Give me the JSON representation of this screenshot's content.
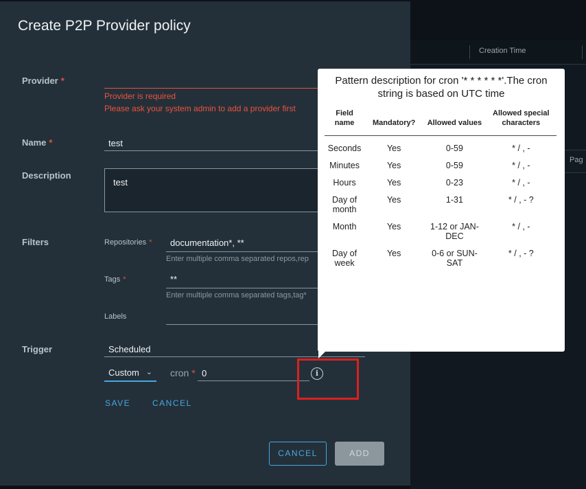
{
  "background": {
    "column_header": "Creation Time",
    "pagination_text": "Pag"
  },
  "modal": {
    "title": "Create P2P Provider policy",
    "provider": {
      "label": "Provider",
      "value": "",
      "error_required": "Provider is required",
      "error_hint": "Please ask your system admin to add a provider first"
    },
    "name": {
      "label": "Name",
      "value": "test"
    },
    "description": {
      "label": "Description",
      "value": "test"
    },
    "filters": {
      "label": "Filters",
      "repositories": {
        "label": "Repositories",
        "value": "documentation*, **",
        "hint": "Enter multiple comma separated repos,rep"
      },
      "tags": {
        "label": "Tags",
        "value": "**",
        "hint": "Enter multiple comma separated tags,tag*"
      },
      "labels": {
        "label": "Labels",
        "value": ""
      }
    },
    "trigger": {
      "label": "Trigger",
      "value": "Scheduled",
      "schedule_type": "Custom",
      "cron_label": "cron",
      "cron_value": "0",
      "save_label": "SAVE",
      "cancel_label": "CANCEL"
    },
    "footer": {
      "cancel_label": "CANCEL",
      "add_label": "ADD"
    }
  },
  "popover": {
    "title": "Pattern description for cron '* * * * * *'.The cron string is based on UTC time",
    "headers": [
      "Field name",
      "Mandatory?",
      "Allowed values",
      "Allowed special characters"
    ],
    "rows": [
      {
        "field": "Seconds",
        "mandatory": "Yes",
        "allowed": "0-59",
        "special": "* / , -"
      },
      {
        "field": "Minutes",
        "mandatory": "Yes",
        "allowed": "0-59",
        "special": "* / , -"
      },
      {
        "field": "Hours",
        "mandatory": "Yes",
        "allowed": "0-23",
        "special": "* / , -"
      },
      {
        "field": "Day of month",
        "mandatory": "Yes",
        "allowed": "1-31",
        "special": "* / , - ?"
      },
      {
        "field": "Month",
        "mandatory": "Yes",
        "allowed": "1-12 or JAN-DEC",
        "special": "* / , -"
      },
      {
        "field": "Day of week",
        "mandatory": "Yes",
        "allowed": "0-6 or SUN-SAT",
        "special": "* / , - ?"
      }
    ]
  },
  "colors": {
    "accent": "#49a7de",
    "error": "#e0533d",
    "highlight_box": "#dc2020",
    "modal_bg": "#23303a"
  },
  "icons": {
    "cron_info": "info-circle-icon",
    "select_chevron": "chevron-down-icon"
  }
}
